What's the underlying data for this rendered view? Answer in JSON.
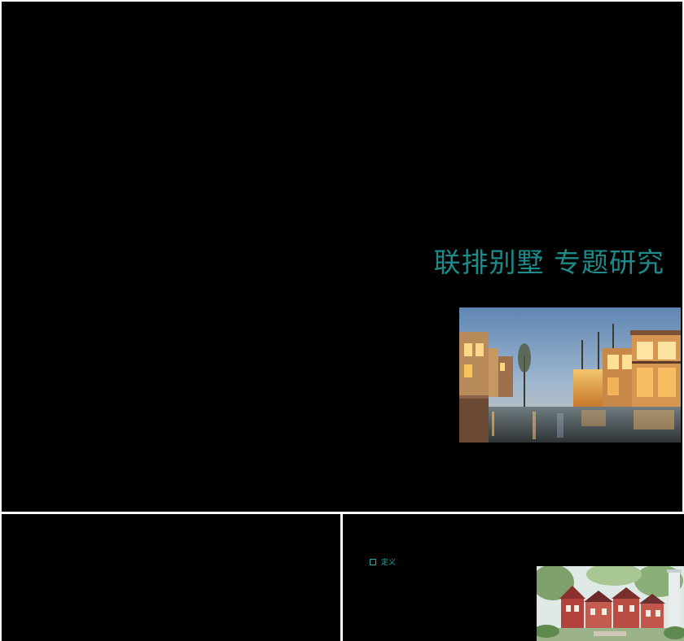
{
  "slides": {
    "main": {
      "title": "联排别墅 专题研究"
    },
    "detail": {
      "bullet_text": "定义"
    }
  },
  "icons": {
    "bullet": "square-bullet-icon"
  },
  "colors": {
    "title": "#1f8a8a",
    "bullet": "#2aa7a7",
    "background": "#000000"
  }
}
